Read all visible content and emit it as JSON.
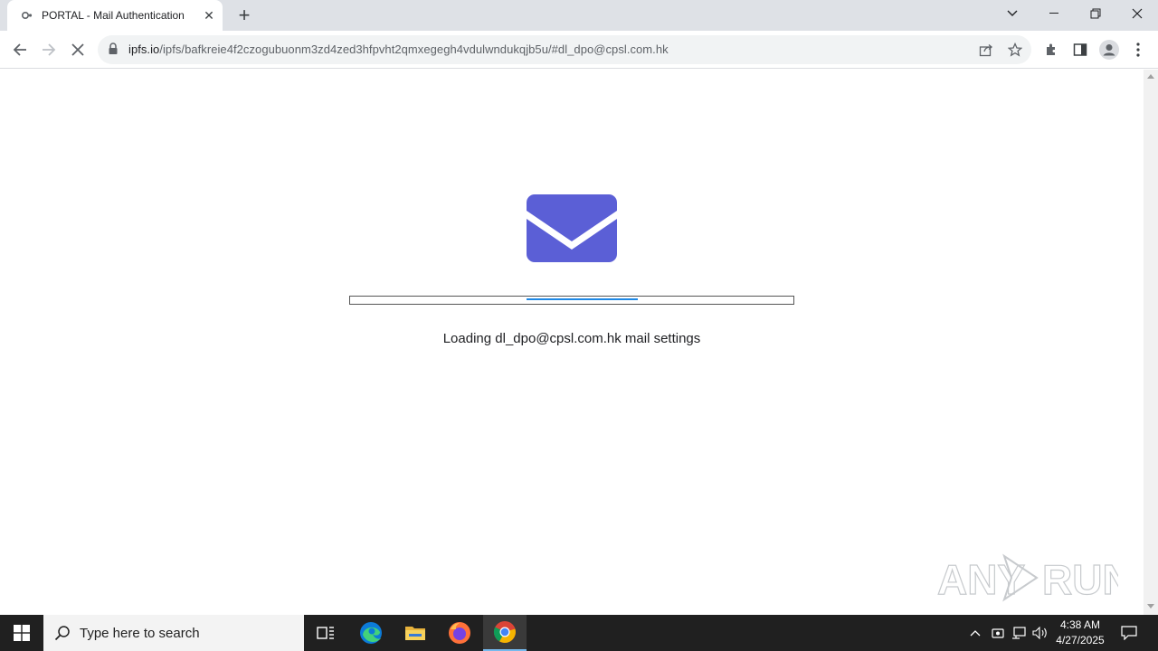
{
  "browser": {
    "tab": {
      "title": "PORTAL - Mail Authentication"
    },
    "address": {
      "host": "ipfs.io",
      "path": "/ipfs/bafkreie4f2czogubuonm3zd4zed3hfpvht2qmxegegh4vdulwndukqjb5u/#dl_dpo@cpsl.com.hk"
    }
  },
  "page": {
    "loading_text": "Loading dl_dpo@cpsl.com.hk mail settings",
    "progress_percent": 25,
    "accent_color": "#5b5fd6"
  },
  "watermark": {
    "text": "ANY RUN"
  },
  "taskbar": {
    "search_placeholder": "Type here to search",
    "time": "4:38 AM",
    "date": "4/27/2025"
  }
}
